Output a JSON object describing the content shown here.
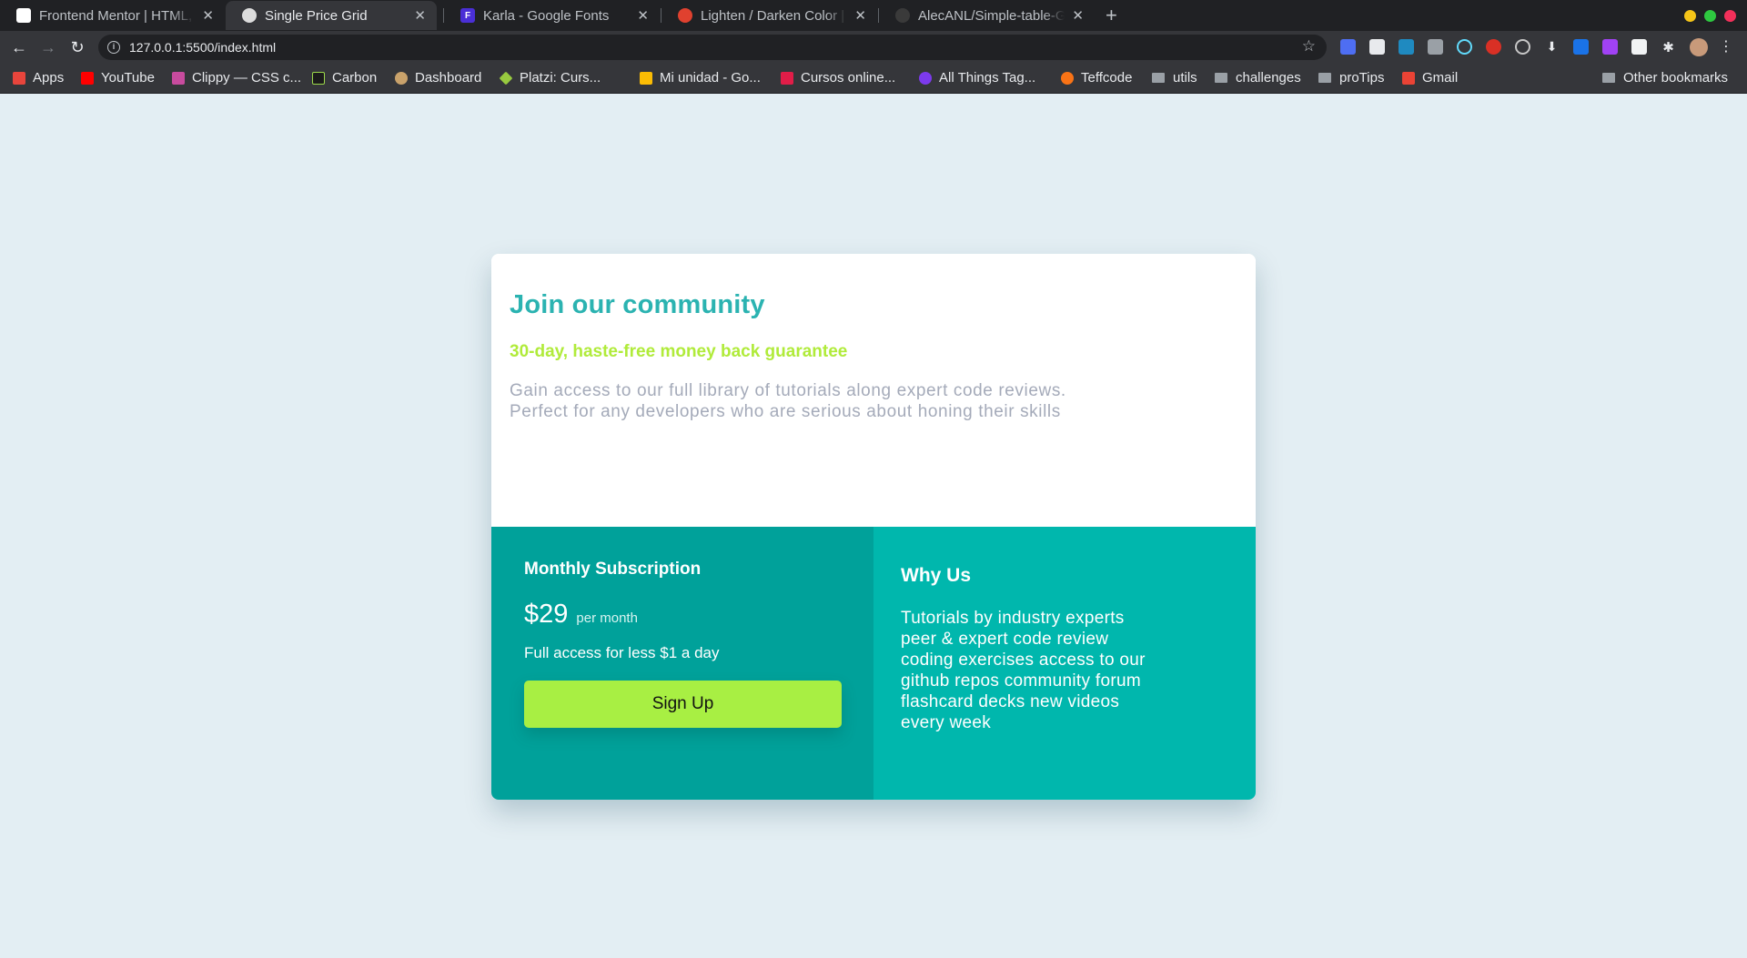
{
  "browser": {
    "tabs": [
      {
        "title": "Frontend Mentor | HTML,",
        "favicon_color": "#ffffff"
      },
      {
        "title": "Single Price Grid",
        "favicon_color": "#dcdcdc",
        "active": true
      },
      {
        "title": "Karla - Google Fonts",
        "favicon_color": "#4a2fd6",
        "favicon_letter": "F"
      },
      {
        "title": "Lighten / Darken Color | C",
        "favicon_color": "#e0412f"
      },
      {
        "title": "AlecANL/Simple-table-Gri",
        "favicon_color": "#3a3a3a"
      }
    ],
    "url": "127.0.0.1:5500/index.html",
    "bookmarks": [
      {
        "label": "Apps",
        "icon_color": "#e8453c"
      },
      {
        "label": "YouTube",
        "icon_color": "#ff0000"
      },
      {
        "label": "Clippy — CSS c...",
        "icon_color": "#c84b9e"
      },
      {
        "label": "Carbon",
        "icon_color": "#1b1b1b"
      },
      {
        "label": "Dashboard",
        "icon_color": "#c9a26b"
      },
      {
        "label": "Platzi: Curs...",
        "icon_color": "#98ca3f"
      },
      {
        "label": "Mi unidad - Go...",
        "icon_color": "#fbbc04"
      },
      {
        "label": "Cursos online...",
        "icon_color": "#e11d48"
      },
      {
        "label": "All Things Tag...",
        "icon_color": "#7c3aed"
      },
      {
        "label": "Teffcode",
        "icon_color": "#f97316"
      },
      {
        "label": "utils",
        "folder": true
      },
      {
        "label": "challenges",
        "folder": true
      },
      {
        "label": "proTips",
        "folder": true
      },
      {
        "label": "Gmail",
        "icon_color": "#ea4335"
      }
    ],
    "other_bookmarks": "Other bookmarks"
  },
  "card": {
    "title": "Join our community",
    "guarantee": "30-day, haste-free money back guarantee",
    "description": "Gain access to our full library of tutorials along expert code reviews. Perfect for any developers who are serious about honing their skills",
    "subscription": {
      "heading": "Monthly Subscription",
      "price": "$29",
      "period": "per month",
      "note": "Full access for less $1 a day",
      "button": "Sign Up"
    },
    "why_us": {
      "heading": "Why Us",
      "text": "Tutorials by industry experts peer & expert code review coding exercises access to our github repos community forum flashcard decks new videos every week"
    }
  },
  "colors": {
    "page_background": "#e3eef3",
    "title_teal": "#2bb3b1",
    "guarantee_lime": "#b0eb3a",
    "left_panel": "#00a19a",
    "right_panel": "#00b7ad",
    "button": "#a8ef43"
  }
}
